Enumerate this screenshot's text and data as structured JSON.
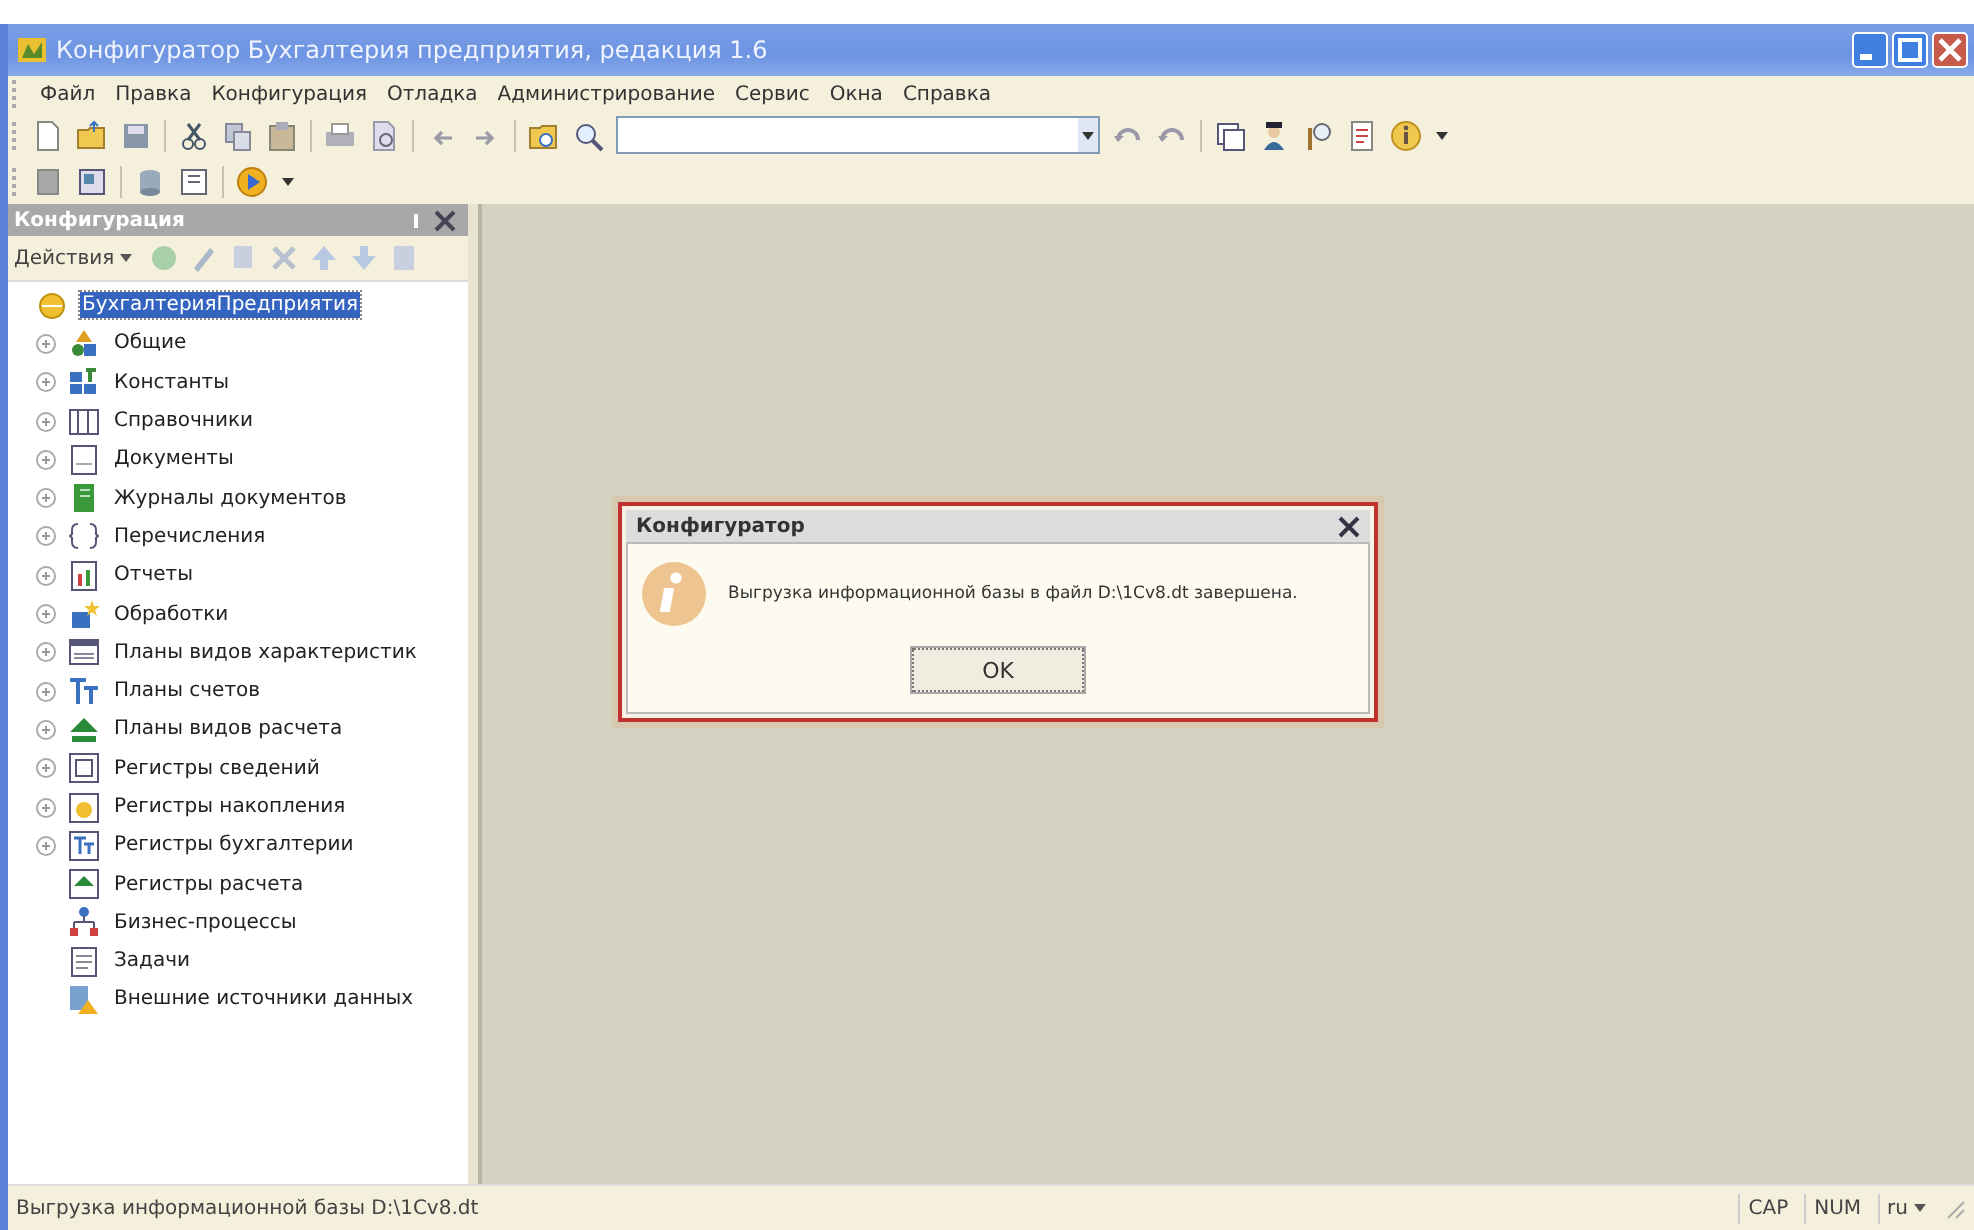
{
  "window": {
    "title": "Конфигуратор   Бухгалтерия предприятия, редакция 1.6"
  },
  "menu": [
    {
      "label": "Файл"
    },
    {
      "label": "Правка"
    },
    {
      "label": "Конфигурация"
    },
    {
      "label": "Отладка"
    },
    {
      "label": "Администрирование"
    },
    {
      "label": "Сервис"
    },
    {
      "label": "Окна"
    },
    {
      "label": "Справка"
    }
  ],
  "panel": {
    "title": "Конфигурация",
    "actions_label": "Действия",
    "tree": {
      "label": "БухгалтерияПредприятия",
      "selected": true,
      "children": [
        {
          "label": "Общие",
          "expandable": true,
          "selected": false
        },
        {
          "label": "Константы",
          "expandable": true,
          "selected": false
        },
        {
          "label": "Справочники",
          "expandable": true,
          "selected": false
        },
        {
          "label": "Документы",
          "expandable": true,
          "selected": false
        },
        {
          "label": "Журналы документов",
          "expandable": true,
          "selected": false
        },
        {
          "label": "Перечисления",
          "expandable": true,
          "selected": false
        },
        {
          "label": "Отчеты",
          "expandable": true,
          "selected": false
        },
        {
          "label": "Обработки",
          "expandable": true,
          "selected": false
        },
        {
          "label": "Планы видов характеристик",
          "expandable": true,
          "selected": false
        },
        {
          "label": "Планы счетов",
          "expandable": true,
          "selected": false
        },
        {
          "label": "Планы видов расчета",
          "expandable": true,
          "selected": false
        },
        {
          "label": "Регистры сведений",
          "expandable": true,
          "selected": false
        },
        {
          "label": "Регистры накопления",
          "expandable": true,
          "selected": false
        },
        {
          "label": "Регистры бухгалтерии",
          "expandable": true,
          "selected": false
        },
        {
          "label": "Регистры расчета",
          "expandable": false,
          "selected": false
        },
        {
          "label": "Бизнес-процессы",
          "expandable": false,
          "selected": false
        },
        {
          "label": "Задачи",
          "expandable": false,
          "selected": false
        },
        {
          "label": "Внешние источники данных",
          "expandable": false,
          "selected": false
        }
      ]
    }
  },
  "dialog": {
    "title": "Конфигуратор",
    "message": "Выгрузка информационной базы в файл D:\\1Cv8.dt завершена.",
    "button": "OK"
  },
  "status_bar": {
    "text": "Выгрузка информационной базы D:\\1Cv8.dt",
    "indicators": [
      "CAP",
      "NUM",
      "ru"
    ]
  }
}
